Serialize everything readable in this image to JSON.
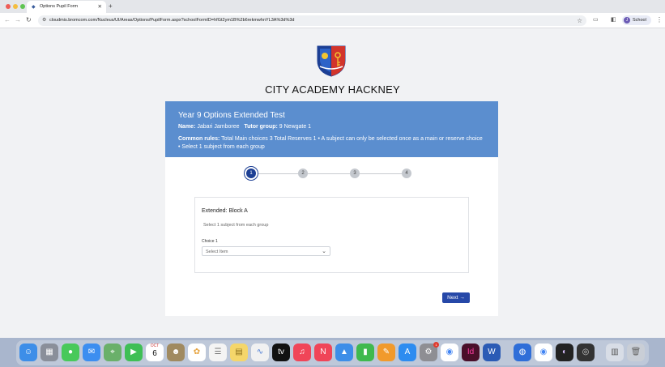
{
  "browser": {
    "tab_title": "Options Pupil Form",
    "url": "cloudmis.bromcom.com/Nucleus/UI/Areas/Options/PupilForm.aspx?schoolFormID=hfGt2ym1B%2b6rekmwhnYL3A%3d%3d",
    "profile_label": "School",
    "profile_initial": "J"
  },
  "school": {
    "name": "CITY ACADEMY HACKNEY"
  },
  "header": {
    "title": "Year 9 Options Extended Test",
    "name_label": "Name:",
    "name_value": "Jabari Jamboree",
    "tutor_label": "Tutor group:",
    "tutor_value": "9 Newgate 1",
    "rules_label": "Common rules:",
    "rules_text": "Total Main choices 3 Total Reserves 1 • A subject can only be selected once as a main or reserve choice • Select 1 subject from each group"
  },
  "stepper": {
    "steps": [
      "1",
      "2",
      "3",
      "4"
    ],
    "active_step": 1
  },
  "block": {
    "title": "Extended: Block A",
    "hint": "Select 1 subject from each group",
    "choice_label": "Choice 1",
    "select_placeholder": "Select Item"
  },
  "actions": {
    "next_label": "Next",
    "next_icon": "arrow-right-icon"
  },
  "dock": {
    "calendar_day": "6",
    "calendar_month": "OCT",
    "badge_count": "1",
    "apps": [
      "finder",
      "launchpad",
      "messages",
      "mail",
      "maps",
      "facetime",
      "calendar",
      "notes",
      "photos",
      "reminders",
      "notes-yellow",
      "freeform",
      "appletv",
      "music",
      "news",
      "keynote",
      "numbers",
      "pages",
      "appstore",
      "settings",
      "chrome",
      "indesign",
      "word",
      "globe",
      "chrome-2",
      "terminal",
      "preview",
      "files",
      "trash"
    ]
  }
}
